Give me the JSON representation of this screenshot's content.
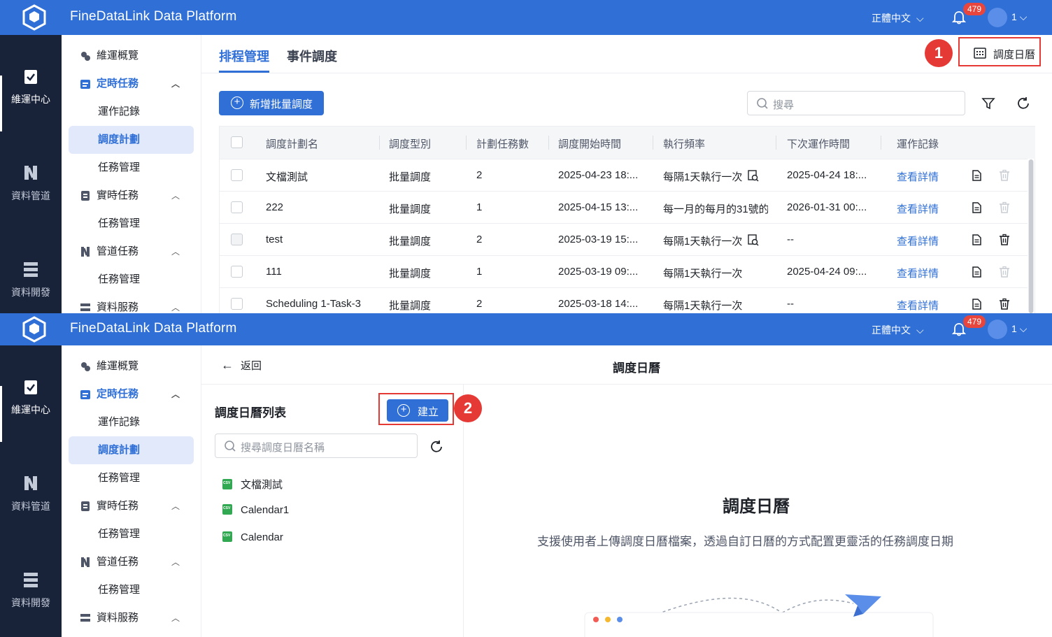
{
  "app": {
    "title": "FineDataLink Data Platform",
    "language": "正體中文",
    "notifications": "479",
    "user": "1"
  },
  "rail": {
    "items": [
      "維運中心",
      "資料管道",
      "資料開發"
    ]
  },
  "menu": {
    "overview": "維運概覽",
    "scheduled": "定時任務",
    "run_log": "運作記錄",
    "plan": "調度計劃",
    "task_mgmt": "任務管理",
    "realtime": "實時任務",
    "pipeline": "管道任務",
    "data_service": "資料服務"
  },
  "panel1": {
    "tabs": [
      "排程管理",
      "事件調度"
    ],
    "calendar_link": "調度日曆",
    "step": "1",
    "add_button": "新增批量調度",
    "search_placeholder": "搜尋",
    "columns": [
      "調度計劃名",
      "調度型別",
      "計劃任務數",
      "調度開始時間",
      "執行頻率",
      "下次運作時間",
      "運作記錄"
    ],
    "rows": [
      {
        "name": "文檔測試",
        "type": "批量調度",
        "count": "2",
        "start": "2025-04-23 18:...",
        "freq": "每隔1天執行一次",
        "next": "2025-04-24 18:...",
        "log": "查看詳情"
      },
      {
        "name": "222",
        "type": "批量調度",
        "count": "1",
        "start": "2025-04-15 13:...",
        "freq": "每一月的每月的31號的",
        "next": "2026-01-31 00:...",
        "log": "查看詳情"
      },
      {
        "name": "test",
        "type": "批量調度",
        "count": "2",
        "start": "2025-03-19 15:...",
        "freq": "每隔1天執行一次",
        "next": "--",
        "log": "查看詳情"
      },
      {
        "name": "111",
        "type": "批量調度",
        "count": "1",
        "start": "2025-03-19 09:...",
        "freq": "每隔1天執行一次",
        "next": "2025-04-24 09:...",
        "log": "查看詳情"
      },
      {
        "name": "Scheduling 1-Task-3",
        "type": "批量調度",
        "count": "2",
        "start": "2025-03-18 14:...",
        "freq": "每隔1天執行一次",
        "next": "--",
        "log": "查看詳情"
      }
    ]
  },
  "panel2": {
    "back": "返回",
    "title": "調度日曆",
    "list_title": "調度日曆列表",
    "create_button": "建立",
    "step": "2",
    "search_placeholder": "搜尋調度日曆名稱",
    "calendars": [
      "文檔測試",
      "Calendar1",
      "Calendar"
    ],
    "empty_title": "調度日曆",
    "empty_desc": "支援使用者上傳調度日曆檔案，透過自訂日曆的方式配置更靈活的任務調度日期"
  },
  "colors": {
    "topbar": "#2f6fd6",
    "rail": "#18233a",
    "accent": "#2f6fd6",
    "highlight": "#e53935"
  }
}
